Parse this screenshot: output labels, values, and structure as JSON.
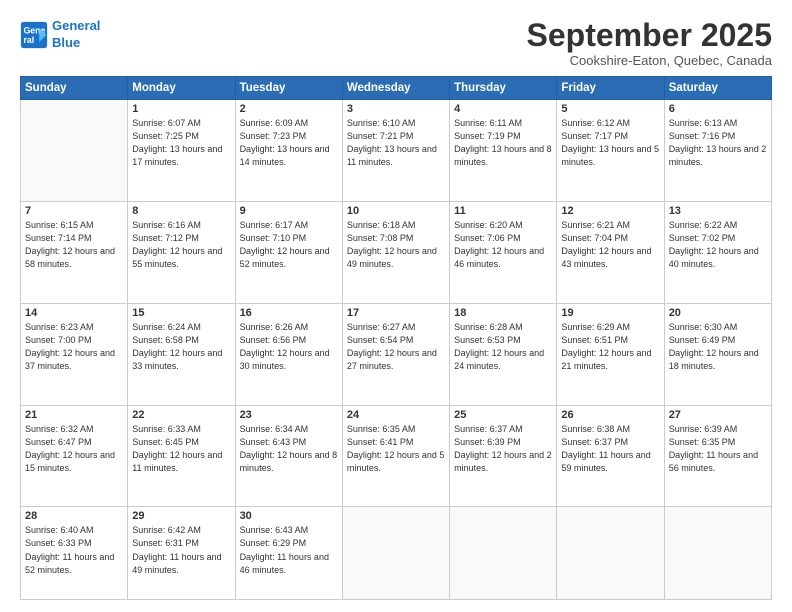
{
  "header": {
    "logo_line1": "General",
    "logo_line2": "Blue",
    "month": "September 2025",
    "location": "Cookshire-Eaton, Quebec, Canada"
  },
  "weekdays": [
    "Sunday",
    "Monday",
    "Tuesday",
    "Wednesday",
    "Thursday",
    "Friday",
    "Saturday"
  ],
  "weeks": [
    [
      {
        "day": "",
        "sunrise": "",
        "sunset": "",
        "daylight": ""
      },
      {
        "day": "1",
        "sunrise": "Sunrise: 6:07 AM",
        "sunset": "Sunset: 7:25 PM",
        "daylight": "Daylight: 13 hours and 17 minutes."
      },
      {
        "day": "2",
        "sunrise": "Sunrise: 6:09 AM",
        "sunset": "Sunset: 7:23 PM",
        "daylight": "Daylight: 13 hours and 14 minutes."
      },
      {
        "day": "3",
        "sunrise": "Sunrise: 6:10 AM",
        "sunset": "Sunset: 7:21 PM",
        "daylight": "Daylight: 13 hours and 11 minutes."
      },
      {
        "day": "4",
        "sunrise": "Sunrise: 6:11 AM",
        "sunset": "Sunset: 7:19 PM",
        "daylight": "Daylight: 13 hours and 8 minutes."
      },
      {
        "day": "5",
        "sunrise": "Sunrise: 6:12 AM",
        "sunset": "Sunset: 7:17 PM",
        "daylight": "Daylight: 13 hours and 5 minutes."
      },
      {
        "day": "6",
        "sunrise": "Sunrise: 6:13 AM",
        "sunset": "Sunset: 7:16 PM",
        "daylight": "Daylight: 13 hours and 2 minutes."
      }
    ],
    [
      {
        "day": "7",
        "sunrise": "Sunrise: 6:15 AM",
        "sunset": "Sunset: 7:14 PM",
        "daylight": "Daylight: 12 hours and 58 minutes."
      },
      {
        "day": "8",
        "sunrise": "Sunrise: 6:16 AM",
        "sunset": "Sunset: 7:12 PM",
        "daylight": "Daylight: 12 hours and 55 minutes."
      },
      {
        "day": "9",
        "sunrise": "Sunrise: 6:17 AM",
        "sunset": "Sunset: 7:10 PM",
        "daylight": "Daylight: 12 hours and 52 minutes."
      },
      {
        "day": "10",
        "sunrise": "Sunrise: 6:18 AM",
        "sunset": "Sunset: 7:08 PM",
        "daylight": "Daylight: 12 hours and 49 minutes."
      },
      {
        "day": "11",
        "sunrise": "Sunrise: 6:20 AM",
        "sunset": "Sunset: 7:06 PM",
        "daylight": "Daylight: 12 hours and 46 minutes."
      },
      {
        "day": "12",
        "sunrise": "Sunrise: 6:21 AM",
        "sunset": "Sunset: 7:04 PM",
        "daylight": "Daylight: 12 hours and 43 minutes."
      },
      {
        "day": "13",
        "sunrise": "Sunrise: 6:22 AM",
        "sunset": "Sunset: 7:02 PM",
        "daylight": "Daylight: 12 hours and 40 minutes."
      }
    ],
    [
      {
        "day": "14",
        "sunrise": "Sunrise: 6:23 AM",
        "sunset": "Sunset: 7:00 PM",
        "daylight": "Daylight: 12 hours and 37 minutes."
      },
      {
        "day": "15",
        "sunrise": "Sunrise: 6:24 AM",
        "sunset": "Sunset: 6:58 PM",
        "daylight": "Daylight: 12 hours and 33 minutes."
      },
      {
        "day": "16",
        "sunrise": "Sunrise: 6:26 AM",
        "sunset": "Sunset: 6:56 PM",
        "daylight": "Daylight: 12 hours and 30 minutes."
      },
      {
        "day": "17",
        "sunrise": "Sunrise: 6:27 AM",
        "sunset": "Sunset: 6:54 PM",
        "daylight": "Daylight: 12 hours and 27 minutes."
      },
      {
        "day": "18",
        "sunrise": "Sunrise: 6:28 AM",
        "sunset": "Sunset: 6:53 PM",
        "daylight": "Daylight: 12 hours and 24 minutes."
      },
      {
        "day": "19",
        "sunrise": "Sunrise: 6:29 AM",
        "sunset": "Sunset: 6:51 PM",
        "daylight": "Daylight: 12 hours and 21 minutes."
      },
      {
        "day": "20",
        "sunrise": "Sunrise: 6:30 AM",
        "sunset": "Sunset: 6:49 PM",
        "daylight": "Daylight: 12 hours and 18 minutes."
      }
    ],
    [
      {
        "day": "21",
        "sunrise": "Sunrise: 6:32 AM",
        "sunset": "Sunset: 6:47 PM",
        "daylight": "Daylight: 12 hours and 15 minutes."
      },
      {
        "day": "22",
        "sunrise": "Sunrise: 6:33 AM",
        "sunset": "Sunset: 6:45 PM",
        "daylight": "Daylight: 12 hours and 11 minutes."
      },
      {
        "day": "23",
        "sunrise": "Sunrise: 6:34 AM",
        "sunset": "Sunset: 6:43 PM",
        "daylight": "Daylight: 12 hours and 8 minutes."
      },
      {
        "day": "24",
        "sunrise": "Sunrise: 6:35 AM",
        "sunset": "Sunset: 6:41 PM",
        "daylight": "Daylight: 12 hours and 5 minutes."
      },
      {
        "day": "25",
        "sunrise": "Sunrise: 6:37 AM",
        "sunset": "Sunset: 6:39 PM",
        "daylight": "Daylight: 12 hours and 2 minutes."
      },
      {
        "day": "26",
        "sunrise": "Sunrise: 6:38 AM",
        "sunset": "Sunset: 6:37 PM",
        "daylight": "Daylight: 11 hours and 59 minutes."
      },
      {
        "day": "27",
        "sunrise": "Sunrise: 6:39 AM",
        "sunset": "Sunset: 6:35 PM",
        "daylight": "Daylight: 11 hours and 56 minutes."
      }
    ],
    [
      {
        "day": "28",
        "sunrise": "Sunrise: 6:40 AM",
        "sunset": "Sunset: 6:33 PM",
        "daylight": "Daylight: 11 hours and 52 minutes."
      },
      {
        "day": "29",
        "sunrise": "Sunrise: 6:42 AM",
        "sunset": "Sunset: 6:31 PM",
        "daylight": "Daylight: 11 hours and 49 minutes."
      },
      {
        "day": "30",
        "sunrise": "Sunrise: 6:43 AM",
        "sunset": "Sunset: 6:29 PM",
        "daylight": "Daylight: 11 hours and 46 minutes."
      },
      {
        "day": "",
        "sunrise": "",
        "sunset": "",
        "daylight": ""
      },
      {
        "day": "",
        "sunrise": "",
        "sunset": "",
        "daylight": ""
      },
      {
        "day": "",
        "sunrise": "",
        "sunset": "",
        "daylight": ""
      },
      {
        "day": "",
        "sunrise": "",
        "sunset": "",
        "daylight": ""
      }
    ]
  ]
}
